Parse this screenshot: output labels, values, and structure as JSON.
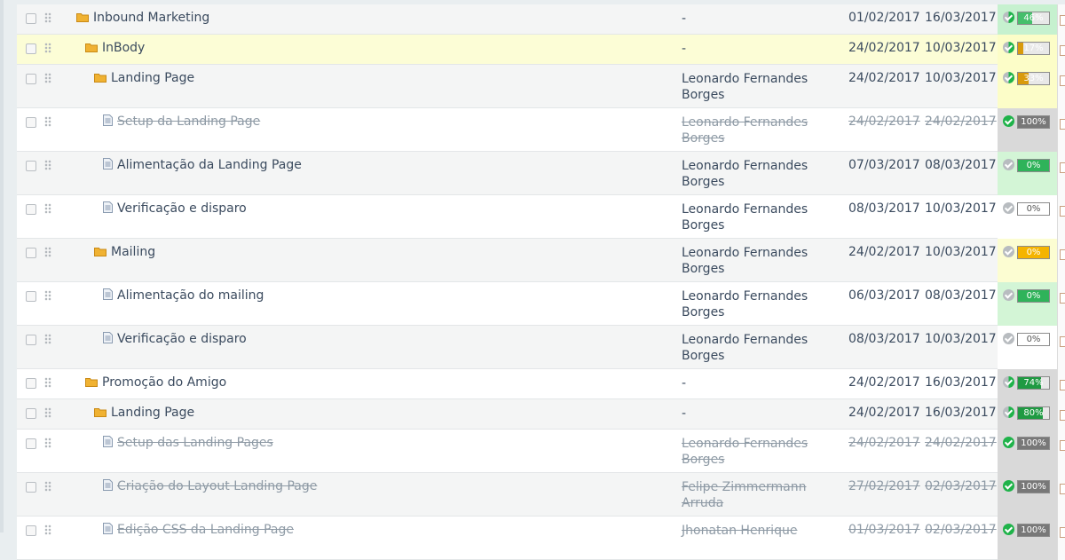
{
  "rows": [
    {
      "name": "Inbound Marketing",
      "type": "folder",
      "level": 0,
      "owner": "-",
      "start": "01/02/2017",
      "end": "16/03/2017",
      "percent": 46,
      "pct_label": "46%",
      "status": "partial",
      "bar_color": "#45bf6b",
      "done": false,
      "selected": false
    },
    {
      "name": "InBody",
      "type": "folder",
      "level": 1,
      "owner": "-",
      "start": "24/02/2017",
      "end": "10/03/2017",
      "percent": 17,
      "pct_label": "17%",
      "status": "partial",
      "bar_color": "#d99a0c",
      "done": false,
      "selected": true
    },
    {
      "name": "Landing Page",
      "type": "folder",
      "level": 2,
      "owner": "Leonardo Fernandes Borges",
      "start": "24/02/2017",
      "end": "10/03/2017",
      "percent": 33,
      "pct_label": "33%",
      "status": "partial",
      "bar_color": "#d99a0c",
      "done": false,
      "selected": false
    },
    {
      "name": "Setup da Landing Page",
      "type": "doc",
      "level": 3,
      "owner": "Leonardo Fernandes Borges",
      "start": "24/02/2017",
      "end": "24/02/2017",
      "percent": 100,
      "pct_label": "100%",
      "status": "complete",
      "bar_color": "#787878",
      "done": true,
      "selected": false
    },
    {
      "name": "Alimentação da Landing Page",
      "type": "doc",
      "level": 3,
      "owner": "Leonardo Fernandes Borges",
      "start": "07/03/2017",
      "end": "08/03/2017",
      "percent": 0,
      "pct_label": "0%",
      "status": "pending",
      "bar_color": "#2fb35a",
      "done": false,
      "selected": false
    },
    {
      "name": "Verificação e disparo",
      "type": "doc",
      "level": 3,
      "owner": "Leonardo Fernandes Borges",
      "start": "08/03/2017",
      "end": "10/03/2017",
      "percent": 0,
      "pct_label": "0%",
      "status": "pending",
      "bar_color": "#ffffff",
      "done": false,
      "selected": false
    },
    {
      "name": "Mailing",
      "type": "folder",
      "level": 2,
      "owner": "Leonardo Fernandes Borges",
      "start": "24/02/2017",
      "end": "10/03/2017",
      "percent": 0,
      "pct_label": "0%",
      "status": "pending",
      "bar_color": "#f5b400",
      "done": false,
      "selected": false
    },
    {
      "name": "Alimentação do mailing",
      "type": "doc",
      "level": 3,
      "owner": "Leonardo Fernandes Borges",
      "start": "06/03/2017",
      "end": "08/03/2017",
      "percent": 0,
      "pct_label": "0%",
      "status": "pending",
      "bar_color": "#2fb35a",
      "done": false,
      "selected": false
    },
    {
      "name": "Verificação e disparo",
      "type": "doc",
      "level": 3,
      "owner": "Leonardo Fernandes Borges",
      "start": "08/03/2017",
      "end": "10/03/2017",
      "percent": 0,
      "pct_label": "0%",
      "status": "pending",
      "bar_color": "#ffffff",
      "done": false,
      "selected": false
    },
    {
      "name": "Promoção do Amigo",
      "type": "folder",
      "level": 1,
      "owner": "-",
      "start": "24/02/2017",
      "end": "16/03/2017",
      "percent": 74,
      "pct_label": "74%",
      "status": "partial",
      "bar_color": "#1f9a42",
      "done": false,
      "selected": false
    },
    {
      "name": "Landing Page",
      "type": "folder",
      "level": 2,
      "owner": "-",
      "start": "24/02/2017",
      "end": "16/03/2017",
      "percent": 80,
      "pct_label": "80%",
      "status": "partial",
      "bar_color": "#1f9a42",
      "done": false,
      "selected": false
    },
    {
      "name": "Setup das Landing Pages",
      "type": "doc",
      "level": 3,
      "owner": "Leonardo Fernandes Borges",
      "start": "24/02/2017",
      "end": "24/02/2017",
      "percent": 100,
      "pct_label": "100%",
      "status": "complete",
      "bar_color": "#787878",
      "done": true,
      "selected": false
    },
    {
      "name": "Criação do Layout Landing Page",
      "type": "doc",
      "level": 3,
      "owner": "Felipe Zimmermann Arruda",
      "start": "27/02/2017",
      "end": "02/03/2017",
      "percent": 100,
      "pct_label": "100%",
      "status": "complete",
      "bar_color": "#787878",
      "done": true,
      "selected": false
    },
    {
      "name": "Edição CSS da Landing Page",
      "type": "doc",
      "level": 3,
      "owner": "Jhonatan Henrique",
      "start": "01/03/2017",
      "end": "02/03/2017",
      "percent": 100,
      "pct_label": "100%",
      "status": "complete",
      "bar_color": "#787878",
      "done": true,
      "selected": false
    }
  ],
  "status_bg": {
    "partial_0": "#c6f1cf",
    "partial_1": "#fcfdc8",
    "partial_2": "#fcfdc8",
    "complete": "#d9d9d9",
    "pending_green": "#d3f5d6",
    "pending_white": "#ffffff",
    "pending_yellow": "#fcfdd2"
  },
  "colors": {
    "check_green": "#1fb34a",
    "check_grey": "#b8bcc0",
    "folder": "#f0b232",
    "doc": "#8a9bb0"
  }
}
